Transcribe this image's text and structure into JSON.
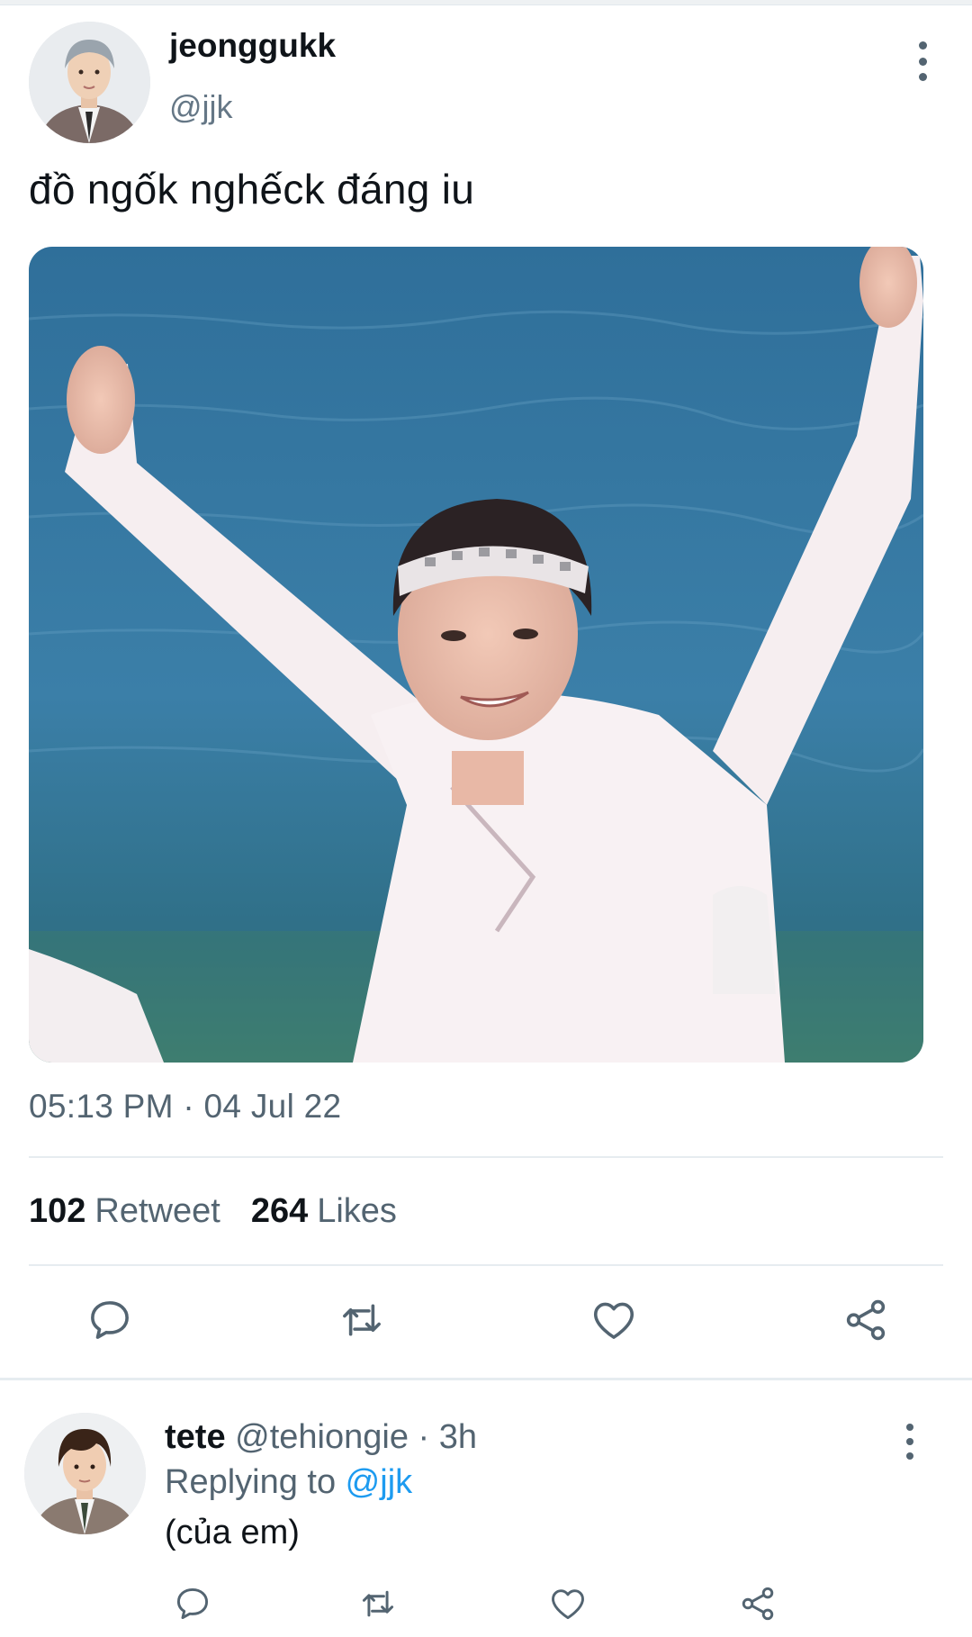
{
  "tweet": {
    "display_name": "jeonggukk",
    "handle": "@jjk",
    "text": "đồ ngốk nghếck đáng iu",
    "timestamp": "05:13 PM · 04 Jul 22",
    "stats": {
      "retweets_count": "102",
      "retweets_label": "Retweet",
      "likes_count": "264",
      "likes_label": "Likes"
    },
    "actions": [
      "reply-icon",
      "retweet-icon",
      "like-icon",
      "share-icon"
    ]
  },
  "reply": {
    "display_name": "tete",
    "handle": "@tehiongie",
    "separator": " · ",
    "time": "3h",
    "replying_prefix": "Replying to ",
    "replying_to": "@jjk",
    "text": "(của em)"
  },
  "colors": {
    "text": "#0f1419",
    "secondary": "#536471",
    "accent": "#1d9bf0",
    "divider": "#e6ecf0",
    "icon": "#536471"
  }
}
